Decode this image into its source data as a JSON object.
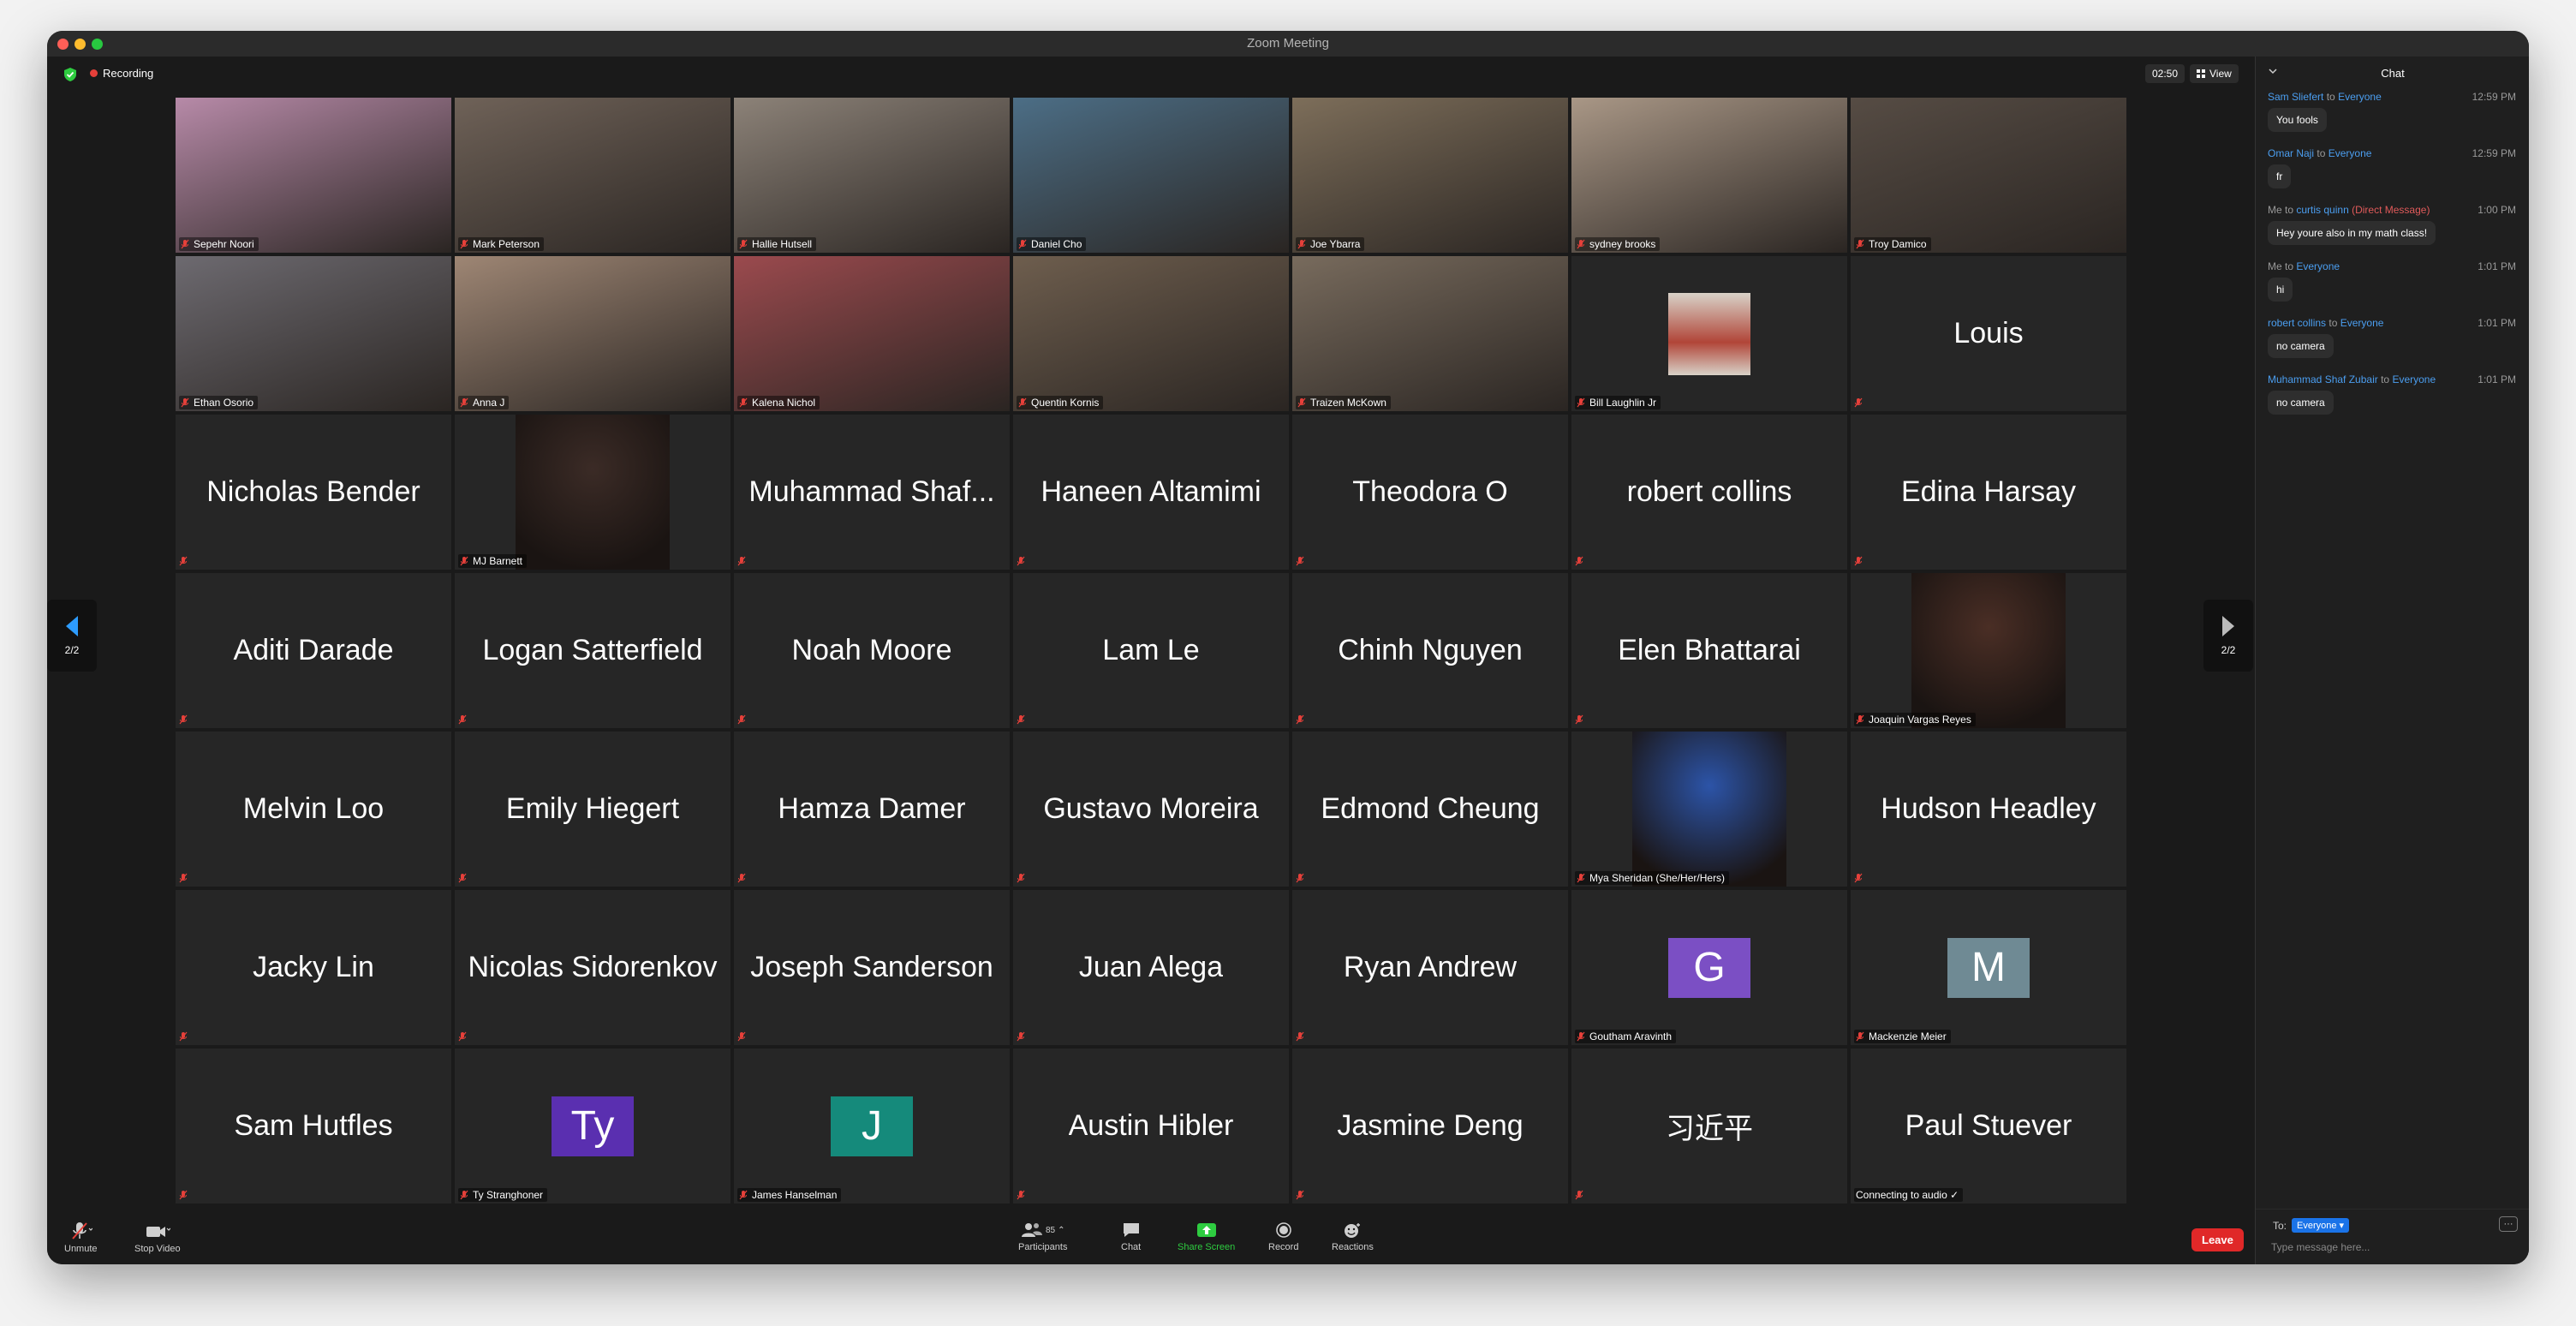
{
  "window": {
    "title": "Zoom Meeting"
  },
  "topbar": {
    "recording_label": "Recording",
    "timer": "02:50",
    "view_label": "View"
  },
  "navigation": {
    "page_left": "2/2",
    "page_right": "2/2"
  },
  "participants": [
    {
      "name": "Sepehr Noori",
      "display": "video",
      "color": "#b78aa8"
    },
    {
      "name": "Mark Peterson",
      "display": "video",
      "color": "#6f6258"
    },
    {
      "name": "Hallie Hutsell",
      "display": "video",
      "color": "#8c8278"
    },
    {
      "name": "Daniel Cho",
      "display": "video",
      "color": "#4c6e86"
    },
    {
      "name": "Joe Ybarra",
      "display": "video",
      "color": "#7d6e5a"
    },
    {
      "name": "sydney brooks",
      "display": "video",
      "color": "#a99786"
    },
    {
      "name": "Troy Damico",
      "display": "video",
      "color": "#564c44"
    },
    {
      "name": "Ethan Osorio",
      "display": "video",
      "color": "#6d6a70"
    },
    {
      "name": "Anna J",
      "display": "video",
      "color": "#9e8674"
    },
    {
      "name": "Kalena Nichol",
      "display": "video",
      "color": "#9b4a4e"
    },
    {
      "name": "Quentin Kornis",
      "display": "video",
      "color": "#6e5e4e"
    },
    {
      "name": "Traizen McKown",
      "display": "video",
      "color": "#786b5d"
    },
    {
      "name": "Bill Laughlin Jr",
      "display": "photo-small",
      "color": "#b14538"
    },
    {
      "name": "Louis",
      "display": "name"
    },
    {
      "name": "Nicholas Bender",
      "display": "name"
    },
    {
      "name": "MJ Barnett",
      "display": "photo",
      "color": "#3b2b26"
    },
    {
      "name": "Muhammad Shaf...",
      "display": "name"
    },
    {
      "name": "Haneen Altamimi",
      "display": "name"
    },
    {
      "name": "Theodora O",
      "display": "name"
    },
    {
      "name": "robert collins",
      "display": "name"
    },
    {
      "name": "Edina Harsay",
      "display": "name"
    },
    {
      "name": "Aditi Darade",
      "display": "name"
    },
    {
      "name": "Logan Satterfield",
      "display": "name"
    },
    {
      "name": "Noah Moore",
      "display": "name"
    },
    {
      "name": "Lam Le",
      "display": "name"
    },
    {
      "name": "Chinh Nguyen",
      "display": "name"
    },
    {
      "name": "Elen Bhattarai",
      "display": "name"
    },
    {
      "name": "Joaquin Vargas Reyes",
      "display": "photo",
      "color": "#4a2e25"
    },
    {
      "name": "Melvin Loo",
      "display": "name"
    },
    {
      "name": "Emily Hiegert",
      "display": "name"
    },
    {
      "name": "Hamza Damer",
      "display": "name"
    },
    {
      "name": "Gustavo Moreira",
      "display": "name"
    },
    {
      "name": "Edmond Cheung",
      "display": "name"
    },
    {
      "name": "Mya Sheridan (She/Her/Hers)",
      "display": "photo",
      "color": "#2c54a8"
    },
    {
      "name": "Hudson Headley",
      "display": "name"
    },
    {
      "name": "Jacky Lin",
      "display": "name"
    },
    {
      "name": "Nicolas Sidorenkov",
      "display": "name"
    },
    {
      "name": "Joseph Sanderson",
      "display": "name"
    },
    {
      "name": "Juan Alega",
      "display": "name"
    },
    {
      "name": "Ryan Andrew",
      "display": "name"
    },
    {
      "name": "Goutham Aravinth",
      "display": "avatar",
      "initial": "G",
      "color": "#7b4fc4"
    },
    {
      "name": "Mackenzie Meier",
      "display": "avatar",
      "initial": "M",
      "color": "#6f8a94"
    },
    {
      "name": "Sam Hutfles",
      "display": "name"
    },
    {
      "name": "Ty Stranghoner",
      "display": "avatar",
      "initial": "Ty",
      "color": "#5a2fb0"
    },
    {
      "name": "James Hanselman",
      "display": "avatar",
      "initial": "J",
      "color": "#158a7b"
    },
    {
      "name": "Austin Hibler",
      "display": "name"
    },
    {
      "name": "Jasmine Deng",
      "display": "name"
    },
    {
      "name": "习近平",
      "display": "name",
      "cjk": true
    },
    {
      "name": "Paul Stuever",
      "display": "name-status",
      "status": "Connecting to audio ✓"
    }
  ],
  "toolbar": {
    "unmute_label": "Unmute",
    "stop_video_label": "Stop Video",
    "participants_label": "Participants",
    "participants_count": "85",
    "chat_label": "Chat",
    "share_label": "Share Screen",
    "record_label": "Record",
    "reactions_label": "Reactions",
    "leave_label": "Leave"
  },
  "chat": {
    "title": "Chat",
    "messages": [
      {
        "from": "Sam Sliefert",
        "connector": "to",
        "to": "Everyone",
        "direct": "",
        "time": "12:59 PM",
        "text": "You fools"
      },
      {
        "from": "Omar Naji",
        "connector": "to",
        "to": "Everyone",
        "direct": "",
        "time": "12:59 PM",
        "text": "fr"
      },
      {
        "from": "Me",
        "connector": "to",
        "to": "curtis quinn",
        "direct": "(Direct Message)",
        "time": "1:00 PM",
        "text": "Hey youre also in my math class!"
      },
      {
        "from": "Me",
        "connector": "to",
        "to": "Everyone",
        "direct": "",
        "time": "1:01 PM",
        "text": "hi"
      },
      {
        "from": "robert collins",
        "connector": "to",
        "to": "Everyone",
        "direct": "",
        "time": "1:01 PM",
        "text": "no camera"
      },
      {
        "from": "Muhammad Shaf Zubair",
        "connector": "to",
        "to": "Everyone",
        "direct": "",
        "time": "1:01 PM",
        "text": "no camera"
      }
    ],
    "to_label": "To:",
    "recipient": "Everyone",
    "more_label": "···",
    "input_placeholder": "Type message here..."
  }
}
